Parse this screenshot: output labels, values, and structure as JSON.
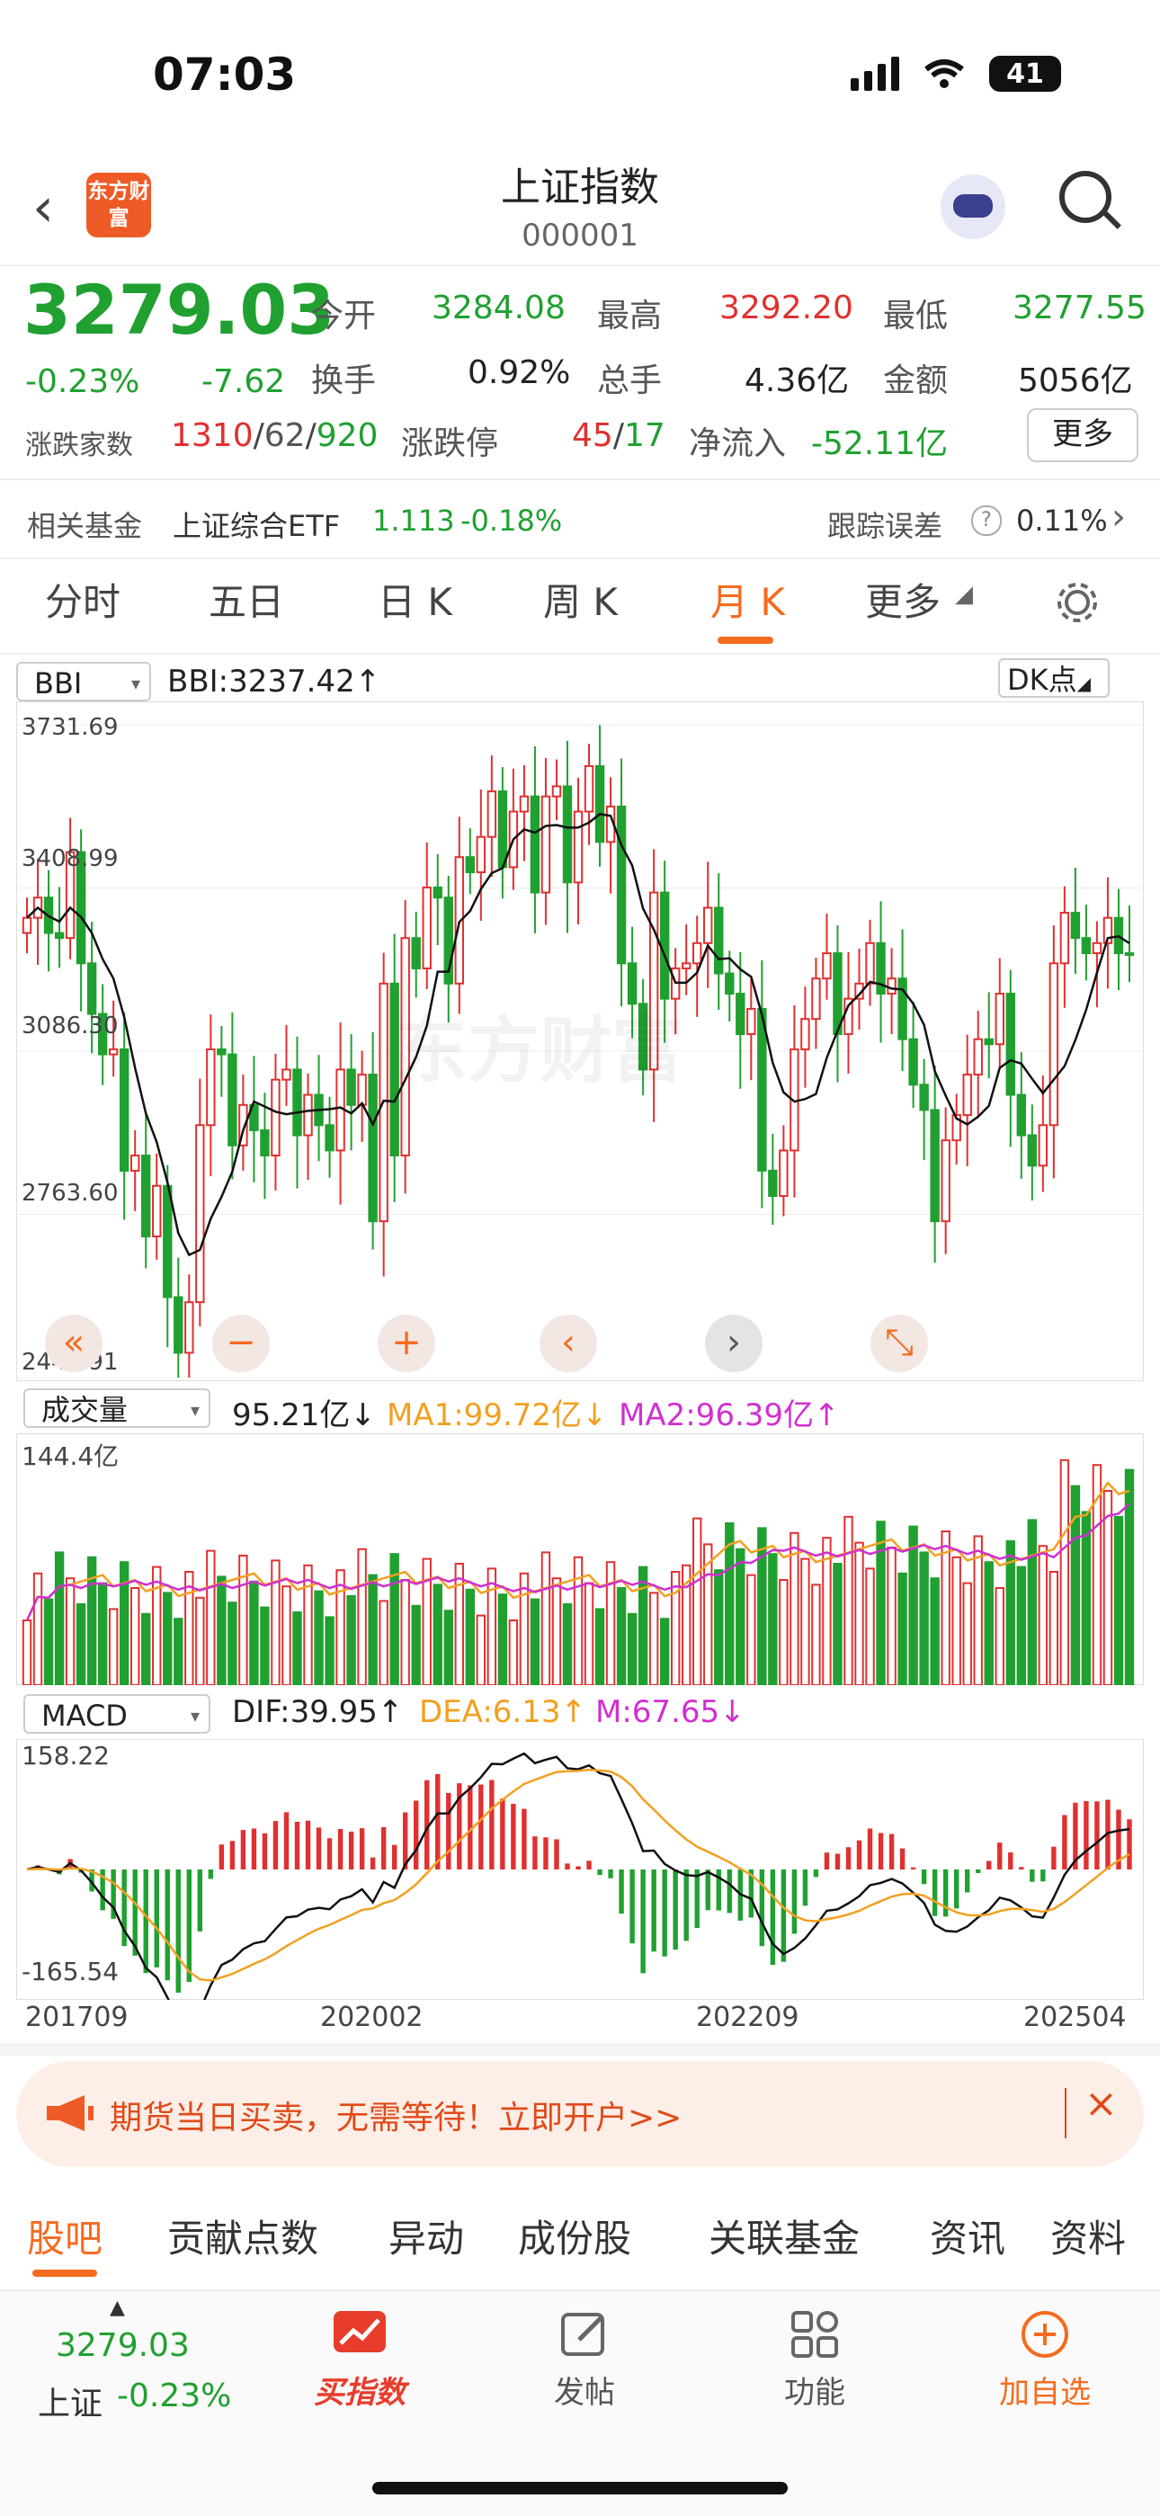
{
  "status": {
    "time": "07:03",
    "battery": "41"
  },
  "header": {
    "title": "上证指数",
    "code": "000001",
    "logo_text": "东方财富"
  },
  "quote": {
    "price": "3279.03",
    "change_pct": "-0.23%",
    "change": "-7.62",
    "open_label": "今开",
    "open": "3284.08",
    "high_label": "最高",
    "high": "3292.20",
    "low_label": "最低",
    "low": "3277.55",
    "turnover_label": "换手",
    "turnover": "0.92%",
    "volume_label": "总手",
    "volume": "4.36亿",
    "amount_label": "金额",
    "amount": "5056亿",
    "breadth_label": "涨跌家数",
    "adv": "1310",
    "flat": "62",
    "dec": "920",
    "limit_label": "涨跌停",
    "limit_up": "45",
    "limit_down": "17",
    "netflow_label": "净流入",
    "netflow": "-52.11亿",
    "more_label": "更多"
  },
  "fund": {
    "label": "相关基金",
    "name": "上证综合ETF",
    "price": "1.113",
    "pct": "-0.18%",
    "track_label": "跟踪误差",
    "track": "0.11%"
  },
  "tabs": [
    "分时",
    "五日",
    "日 K",
    "周 K",
    "月 K",
    "更多"
  ],
  "active_tab": 4,
  "chart": {
    "indicator": "BBI",
    "indicator_value": "BBI:3237.42",
    "dk_label": "DK点",
    "y_ticks": [
      "3731.69",
      "3408.99",
      "3086.30",
      "2763.60",
      "2440.91"
    ],
    "volume_selector": "成交量",
    "volume_value": "95.21亿",
    "ma1": "MA1:99.72亿",
    "ma2": "MA2:96.39亿",
    "vol_top": "144.4亿",
    "macd_selector": "MACD",
    "dif": "DIF:39.95",
    "dea": "DEA:6.13",
    "m": "M:67.65",
    "macd_top": "158.22",
    "macd_bottom": "-165.54",
    "x_ticks": [
      "201709",
      "202002",
      "202209",
      "202504"
    ],
    "watermark": "东方财富",
    "controls": [
      "«",
      "−",
      "+",
      "‹",
      "›",
      "⤡"
    ]
  },
  "chart_data": {
    "type": "candlestick",
    "period": "monthly",
    "x_range": [
      "201709",
      "202504"
    ],
    "ylim": [
      2440.91,
      3731.69
    ],
    "close_approx": [
      3350,
      3390,
      3320,
      3310,
      3480,
      3260,
      3160,
      3080,
      3090,
      2850,
      2880,
      2720,
      2820,
      2600,
      2490,
      2590,
      2940,
      3090,
      3080,
      2900,
      2980,
      2930,
      2880,
      3030,
      3050,
      2920,
      3000,
      2940,
      2890,
      3050,
      2980,
      3040,
      2750,
      3220,
      2880,
      3310,
      3250,
      3410,
      3390,
      3220,
      3470,
      3440,
      3510,
      3600,
      3450,
      3560,
      3590,
      3400,
      3590,
      3610,
      3420,
      3560,
      3650,
      3500,
      3570,
      3260,
      3180,
      3050,
      3400,
      3190,
      3250,
      3260,
      3300,
      3370,
      3240,
      3200,
      3120,
      3170,
      2850,
      2800,
      2890,
      3090,
      3150,
      3230,
      3280,
      3120,
      3190,
      3220,
      3300,
      3200,
      3230,
      3110,
      3020,
      2970,
      2750,
      2910,
      2960,
      3040,
      3110,
      3100,
      3200,
      3000,
      2920,
      2860,
      2940,
      3260,
      3360,
      3310,
      3280,
      3300,
      3350,
      3280,
      3279
    ]
  },
  "banner": {
    "text": "期货当日买卖，无需等待！立即开户>>"
  },
  "bottom_tabs": [
    "股吧",
    "贡献点数",
    "异动",
    "成份股",
    "关联基金",
    "资讯",
    "资料"
  ],
  "navbar": {
    "price": "3279.03",
    "name": "上证",
    "pct": "-0.23%",
    "buy": "买指数",
    "post": "发帖",
    "func": "功能",
    "add": "加自选"
  },
  "colors": {
    "up": "#e03030",
    "down": "#20a030",
    "accent": "#f56b1f",
    "bbi": "#111111",
    "ma1": "#f2a020",
    "ma2": "#d030d0"
  }
}
